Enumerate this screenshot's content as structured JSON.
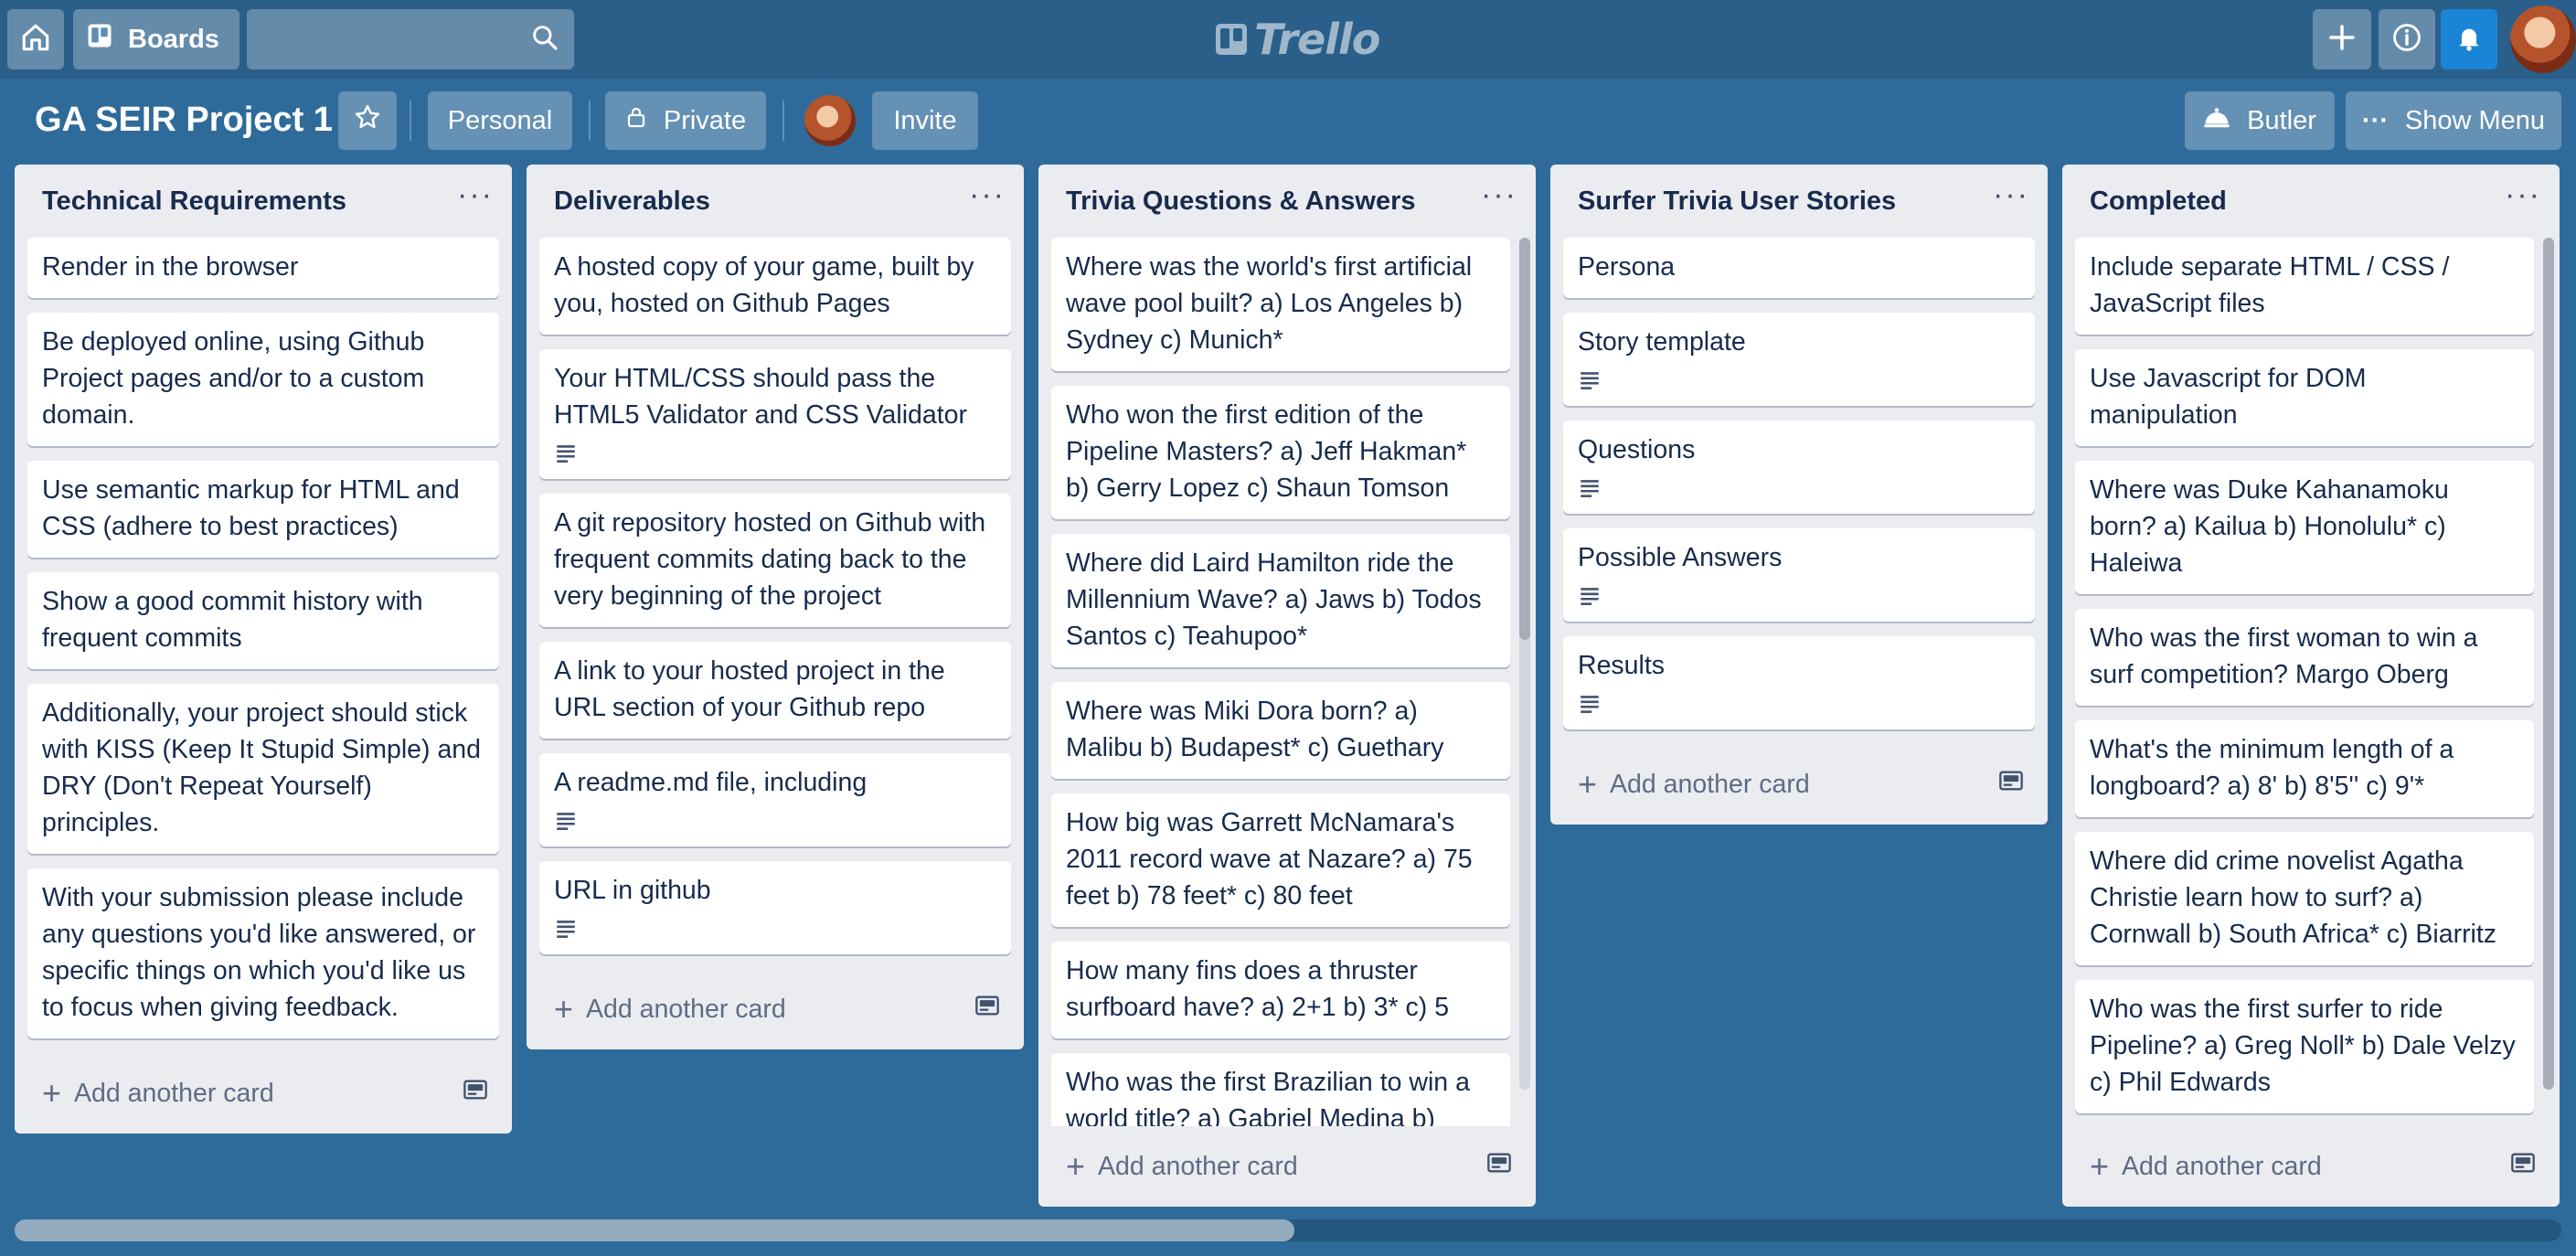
{
  "app": {
    "logo": "Trello"
  },
  "topbar": {
    "boards_label": "Boards",
    "search_placeholder": ""
  },
  "board": {
    "title": "GA SEIR Project 1",
    "personal_label": "Personal",
    "private_label": "Private",
    "invite_label": "Invite",
    "butler_label": "Butler",
    "show_menu_label": "Show Menu"
  },
  "colors": {
    "board_bg": "#2f6b9a",
    "list_bg": "#ebecf0",
    "notification": "#1a85d6"
  },
  "lists": [
    {
      "title": "Technical Requirements",
      "cards": [
        {
          "text": "Render in the browser"
        },
        {
          "text": "Be deployed online, using Github Project pages and/or to a custom domain."
        },
        {
          "text": "Use semantic markup for HTML and CSS (adhere to best practices)"
        },
        {
          "text": "Show a good commit history with frequent commits"
        },
        {
          "text": "Additionally, your project should stick with KISS (Keep It Stupid Simple) and DRY (Don't Repeat Yourself) principles."
        },
        {
          "text": "With your submission please include any questions you'd like answered, or specific things on which you'd like us to focus when giving feedback."
        }
      ],
      "add_label": "Add another card"
    },
    {
      "title": "Deliverables",
      "cards": [
        {
          "text": "A hosted copy of your game, built by you, hosted on Github Pages"
        },
        {
          "text": "Your HTML/CSS should pass the HTML5 Validator and CSS Validator",
          "desc": true
        },
        {
          "text": "A git repository hosted on Github with frequent commits dating back to the very beginning of the project"
        },
        {
          "text": "A link to your hosted project in the URL section of your Github repo"
        },
        {
          "text": "A readme.md file, including",
          "desc": true
        },
        {
          "text": "URL in github",
          "desc": true
        }
      ],
      "add_label": "Add another card"
    },
    {
      "title": "Trivia Questions & Answers",
      "cards": [
        {
          "text": "Where was the world's first artificial wave pool built? a) Los Angeles b) Sydney c) Munich*"
        },
        {
          "text": "Who won the first edition of the Pipeline Masters? a) Jeff Hakman* b) Gerry Lopez c) Shaun Tomson"
        },
        {
          "text": "Where did Laird Hamilton ride the Millennium Wave? a) Jaws b) Todos Santos c) Teahupoo*"
        },
        {
          "text": "Where was Miki Dora born? a) Malibu b) Budapest* c) Guethary"
        },
        {
          "text": "How big was Garrett McNamara's 2011 record wave at Nazare? a) 75 feet b) 78 feet* c) 80 feet"
        },
        {
          "text": "How many fins does a thruster surfboard have? a) 2+1 b) 3* c) 5"
        },
        {
          "text": "Who was the first Brazilian to win a world title? a) Gabriel Medina b)"
        }
      ],
      "add_label": "Add another card"
    },
    {
      "title": "Surfer Trivia User Stories",
      "cards": [
        {
          "text": "Persona"
        },
        {
          "text": "Story template",
          "desc": true
        },
        {
          "text": "Questions",
          "desc": true
        },
        {
          "text": "Possible Answers",
          "desc": true
        },
        {
          "text": "Results",
          "desc": true
        }
      ],
      "add_label": "Add another card"
    },
    {
      "title": "Completed",
      "cards": [
        {
          "text": "Include separate HTML / CSS / JavaScript files"
        },
        {
          "text": "Use Javascript for DOM manipulation"
        },
        {
          "text": "Where was Duke Kahanamoku born? a) Kailua b) Honolulu* c) Haleiwa"
        },
        {
          "text": "Who was the first woman to win a surf competition? Margo Oberg"
        },
        {
          "text": "What's the minimum length of a longboard? a) 8' b) 8'5'' c) 9'*"
        },
        {
          "text": "Where did crime novelist Agatha Christie learn how to surf? a) Cornwall b) South Africa* c) Biarritz"
        },
        {
          "text": "Who was the first surfer to ride Pipeline? a) Greg Noll* b) Dale Velzy c) Phil Edwards"
        },
        {
          "text": ""
        }
      ],
      "add_label": "Add another card"
    }
  ]
}
